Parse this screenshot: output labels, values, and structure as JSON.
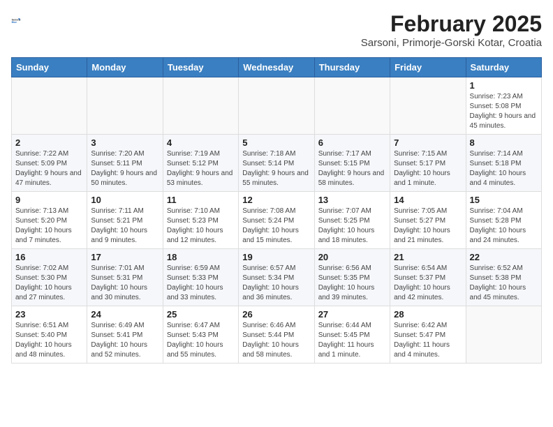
{
  "header": {
    "logo_general": "General",
    "logo_blue": "Blue",
    "month_year": "February 2025",
    "location": "Sarsoni, Primorje-Gorski Kotar, Croatia"
  },
  "days_of_week": [
    "Sunday",
    "Monday",
    "Tuesday",
    "Wednesday",
    "Thursday",
    "Friday",
    "Saturday"
  ],
  "weeks": [
    [
      {
        "day": "",
        "detail": ""
      },
      {
        "day": "",
        "detail": ""
      },
      {
        "day": "",
        "detail": ""
      },
      {
        "day": "",
        "detail": ""
      },
      {
        "day": "",
        "detail": ""
      },
      {
        "day": "",
        "detail": ""
      },
      {
        "day": "1",
        "detail": "Sunrise: 7:23 AM\nSunset: 5:08 PM\nDaylight: 9 hours and 45 minutes."
      }
    ],
    [
      {
        "day": "2",
        "detail": "Sunrise: 7:22 AM\nSunset: 5:09 PM\nDaylight: 9 hours and 47 minutes."
      },
      {
        "day": "3",
        "detail": "Sunrise: 7:20 AM\nSunset: 5:11 PM\nDaylight: 9 hours and 50 minutes."
      },
      {
        "day": "4",
        "detail": "Sunrise: 7:19 AM\nSunset: 5:12 PM\nDaylight: 9 hours and 53 minutes."
      },
      {
        "day": "5",
        "detail": "Sunrise: 7:18 AM\nSunset: 5:14 PM\nDaylight: 9 hours and 55 minutes."
      },
      {
        "day": "6",
        "detail": "Sunrise: 7:17 AM\nSunset: 5:15 PM\nDaylight: 9 hours and 58 minutes."
      },
      {
        "day": "7",
        "detail": "Sunrise: 7:15 AM\nSunset: 5:17 PM\nDaylight: 10 hours and 1 minute."
      },
      {
        "day": "8",
        "detail": "Sunrise: 7:14 AM\nSunset: 5:18 PM\nDaylight: 10 hours and 4 minutes."
      }
    ],
    [
      {
        "day": "9",
        "detail": "Sunrise: 7:13 AM\nSunset: 5:20 PM\nDaylight: 10 hours and 7 minutes."
      },
      {
        "day": "10",
        "detail": "Sunrise: 7:11 AM\nSunset: 5:21 PM\nDaylight: 10 hours and 9 minutes."
      },
      {
        "day": "11",
        "detail": "Sunrise: 7:10 AM\nSunset: 5:23 PM\nDaylight: 10 hours and 12 minutes."
      },
      {
        "day": "12",
        "detail": "Sunrise: 7:08 AM\nSunset: 5:24 PM\nDaylight: 10 hours and 15 minutes."
      },
      {
        "day": "13",
        "detail": "Sunrise: 7:07 AM\nSunset: 5:25 PM\nDaylight: 10 hours and 18 minutes."
      },
      {
        "day": "14",
        "detail": "Sunrise: 7:05 AM\nSunset: 5:27 PM\nDaylight: 10 hours and 21 minutes."
      },
      {
        "day": "15",
        "detail": "Sunrise: 7:04 AM\nSunset: 5:28 PM\nDaylight: 10 hours and 24 minutes."
      }
    ],
    [
      {
        "day": "16",
        "detail": "Sunrise: 7:02 AM\nSunset: 5:30 PM\nDaylight: 10 hours and 27 minutes."
      },
      {
        "day": "17",
        "detail": "Sunrise: 7:01 AM\nSunset: 5:31 PM\nDaylight: 10 hours and 30 minutes."
      },
      {
        "day": "18",
        "detail": "Sunrise: 6:59 AM\nSunset: 5:33 PM\nDaylight: 10 hours and 33 minutes."
      },
      {
        "day": "19",
        "detail": "Sunrise: 6:57 AM\nSunset: 5:34 PM\nDaylight: 10 hours and 36 minutes."
      },
      {
        "day": "20",
        "detail": "Sunrise: 6:56 AM\nSunset: 5:35 PM\nDaylight: 10 hours and 39 minutes."
      },
      {
        "day": "21",
        "detail": "Sunrise: 6:54 AM\nSunset: 5:37 PM\nDaylight: 10 hours and 42 minutes."
      },
      {
        "day": "22",
        "detail": "Sunrise: 6:52 AM\nSunset: 5:38 PM\nDaylight: 10 hours and 45 minutes."
      }
    ],
    [
      {
        "day": "23",
        "detail": "Sunrise: 6:51 AM\nSunset: 5:40 PM\nDaylight: 10 hours and 48 minutes."
      },
      {
        "day": "24",
        "detail": "Sunrise: 6:49 AM\nSunset: 5:41 PM\nDaylight: 10 hours and 52 minutes."
      },
      {
        "day": "25",
        "detail": "Sunrise: 6:47 AM\nSunset: 5:43 PM\nDaylight: 10 hours and 55 minutes."
      },
      {
        "day": "26",
        "detail": "Sunrise: 6:46 AM\nSunset: 5:44 PM\nDaylight: 10 hours and 58 minutes."
      },
      {
        "day": "27",
        "detail": "Sunrise: 6:44 AM\nSunset: 5:45 PM\nDaylight: 11 hours and 1 minute."
      },
      {
        "day": "28",
        "detail": "Sunrise: 6:42 AM\nSunset: 5:47 PM\nDaylight: 11 hours and 4 minutes."
      },
      {
        "day": "",
        "detail": ""
      }
    ]
  ]
}
